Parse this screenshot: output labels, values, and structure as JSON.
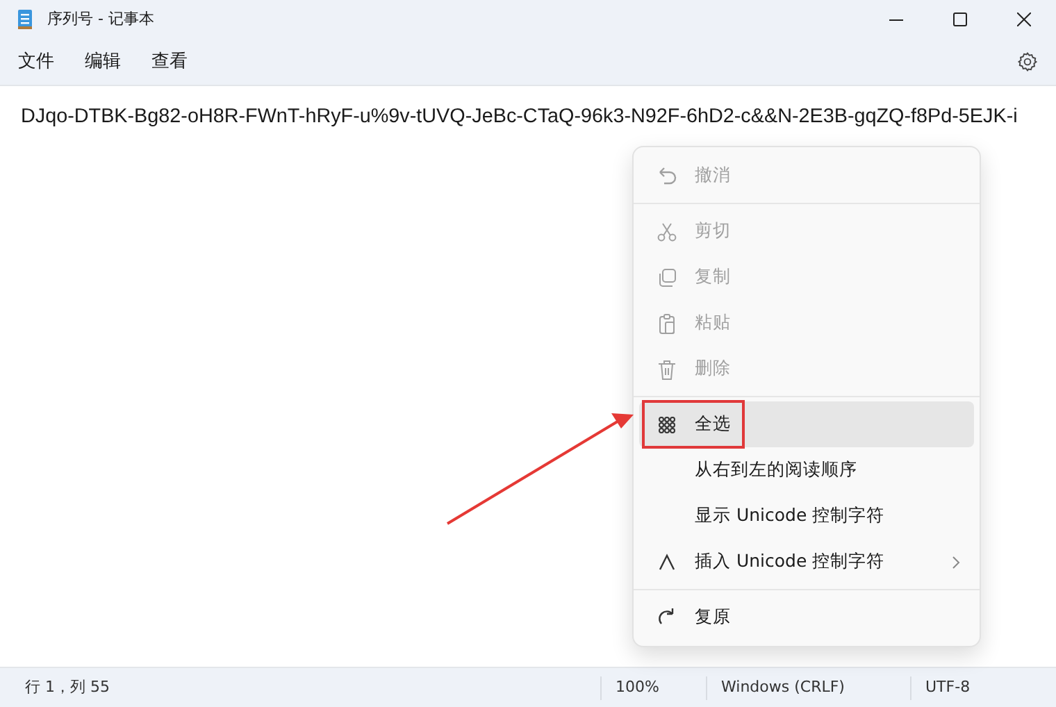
{
  "window": {
    "title": "序列号 - 记事本"
  },
  "menubar": [
    "文件",
    "编辑",
    "查看"
  ],
  "document": {
    "text": "DJqo-DTBK-Bg82-oH8R-FWnT-hRyF-u%9v-tUVQ-JeBc-CTaQ-96k3-N92F-6hD2-c&&N-2E3B-gqZQ-f8Pd-5EJK-i"
  },
  "context_menu": [
    {
      "kind": "item",
      "label": "撤消",
      "disabled": true,
      "selected": false
    },
    {
      "kind": "separator"
    },
    {
      "kind": "item",
      "label": "剪切",
      "disabled": true,
      "selected": false
    },
    {
      "kind": "item",
      "label": "复制",
      "disabled": true,
      "selected": false
    },
    {
      "kind": "item",
      "label": "粘贴",
      "disabled": true,
      "selected": false
    },
    {
      "kind": "item",
      "label": "删除",
      "disabled": true,
      "selected": false
    },
    {
      "kind": "separator"
    },
    {
      "kind": "item",
      "label": "全选",
      "disabled": false,
      "selected": true,
      "highlighted": true
    },
    {
      "kind": "item",
      "label": "从右到左的阅读顺序",
      "disabled": false,
      "selected": false
    },
    {
      "kind": "item",
      "label": "显示 Unicode 控制字符",
      "disabled": false,
      "selected": false
    },
    {
      "kind": "item",
      "label": "插入 Unicode 控制字符",
      "disabled": false,
      "selected": false,
      "submenu": true
    },
    {
      "kind": "separator"
    },
    {
      "kind": "item",
      "label": "复原",
      "disabled": false,
      "selected": false
    }
  ],
  "status_bar": [
    "行 1，列 55",
    "100%",
    "Windows (CRLF)",
    "UTF-8"
  ]
}
